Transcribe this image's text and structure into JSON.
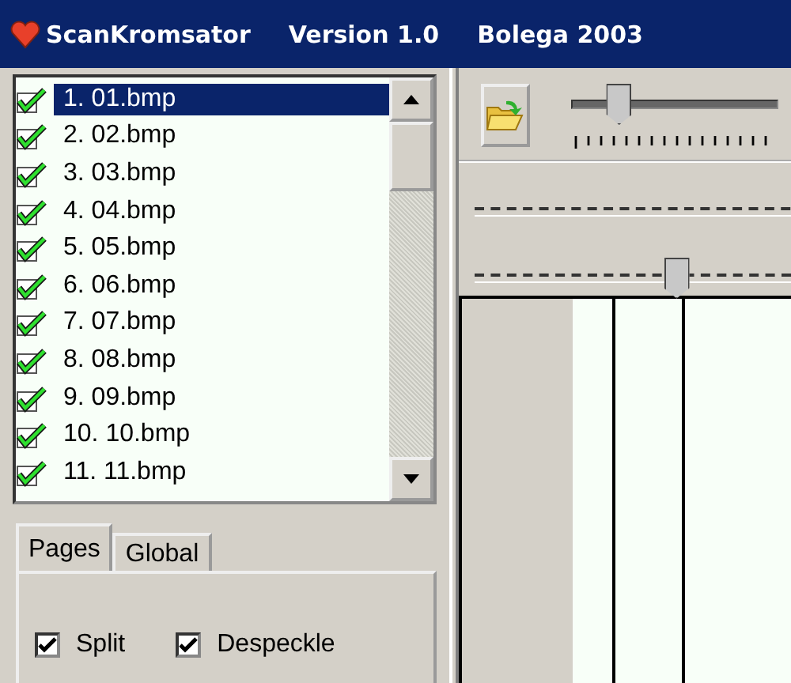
{
  "window": {
    "title": "ScanKromsator",
    "version": "Version 1.0",
    "author": "Bolega 2003"
  },
  "files": [
    {
      "label": "1. 01.bmp",
      "checked": true,
      "selected": true
    },
    {
      "label": "2. 02.bmp",
      "checked": true,
      "selected": false
    },
    {
      "label": "3. 03.bmp",
      "checked": true,
      "selected": false
    },
    {
      "label": "4. 04.bmp",
      "checked": true,
      "selected": false
    },
    {
      "label": "5. 05.bmp",
      "checked": true,
      "selected": false
    },
    {
      "label": "6. 06.bmp",
      "checked": true,
      "selected": false
    },
    {
      "label": "7. 07.bmp",
      "checked": true,
      "selected": false
    },
    {
      "label": "8. 08.bmp",
      "checked": true,
      "selected": false
    },
    {
      "label": "9. 09.bmp",
      "checked": true,
      "selected": false
    },
    {
      "label": "10. 10.bmp",
      "checked": true,
      "selected": false
    },
    {
      "label": "11. 11.bmp",
      "checked": true,
      "selected": false
    }
  ],
  "tabs": [
    {
      "label": "Pages",
      "selected": true
    },
    {
      "label": "Global",
      "selected": false
    }
  ],
  "options": [
    {
      "label": "Split",
      "checked": true
    },
    {
      "label": "Despeckle",
      "checked": true
    }
  ],
  "sliders": [
    {
      "level": 0.25
    },
    {
      "level": 0.66
    }
  ]
}
